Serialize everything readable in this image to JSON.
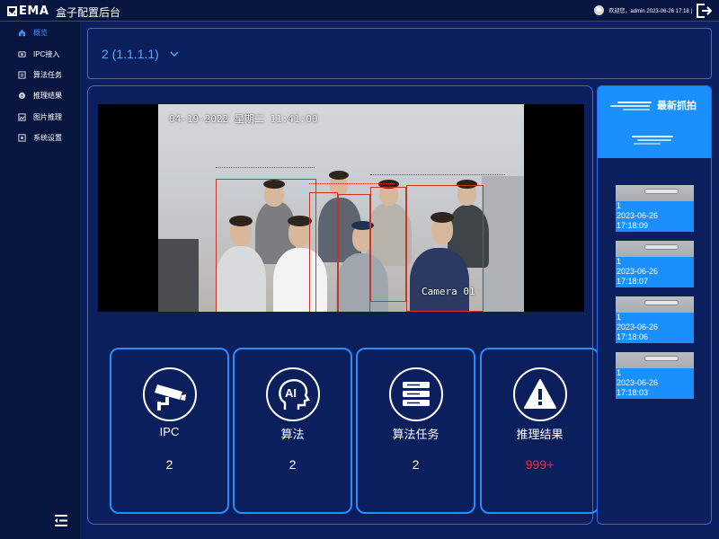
{
  "header": {
    "logo_text": "EMA",
    "title": "盒子配置后台",
    "welcome": "欢迎您，admin 2023-06-26 17:18 |"
  },
  "sidebar": {
    "items": [
      {
        "label": "概览",
        "icon": "home-icon",
        "active": true
      },
      {
        "label": "IPC接入",
        "icon": "camera-icon",
        "active": false
      },
      {
        "label": "算法任务",
        "icon": "task-icon",
        "active": false
      },
      {
        "label": "推理结果",
        "icon": "result-icon",
        "active": false
      },
      {
        "label": "图片推理",
        "icon": "image-icon",
        "active": false
      },
      {
        "label": "系统设置",
        "icon": "settings-icon",
        "active": false
      }
    ]
  },
  "device": {
    "selected": "2  (1.1.1.1)"
  },
  "video": {
    "osd_date": "04-19-2022 星期二 11:41:00",
    "osd_camera": "Camera 01"
  },
  "stats": [
    {
      "label": "IPC",
      "value": "2",
      "icon": "cctv-camera-icon"
    },
    {
      "label": "算法",
      "value": "2",
      "icon": "ai-head-icon"
    },
    {
      "label": "算法任务",
      "value": "2",
      "icon": "server-list-icon"
    },
    {
      "label": "推理结果",
      "value": "999+",
      "icon": "warning-icon",
      "alert_color": "#ff2430"
    }
  ],
  "latest": {
    "title": "最新抓拍",
    "items": [
      {
        "channel": "1",
        "date": "2023-06-26",
        "time": "17:18:09"
      },
      {
        "channel": "1",
        "date": "2023-06-26",
        "time": "17:18:07"
      },
      {
        "channel": "1",
        "date": "2023-06-26",
        "time": "17:18:06"
      },
      {
        "channel": "1",
        "date": "2023-06-26",
        "time": "17:18:03"
      }
    ]
  },
  "colors": {
    "background": "#0a1f5c",
    "accent": "#1a90ff",
    "border": "#2b6ef0",
    "alert": "#ff2430"
  }
}
